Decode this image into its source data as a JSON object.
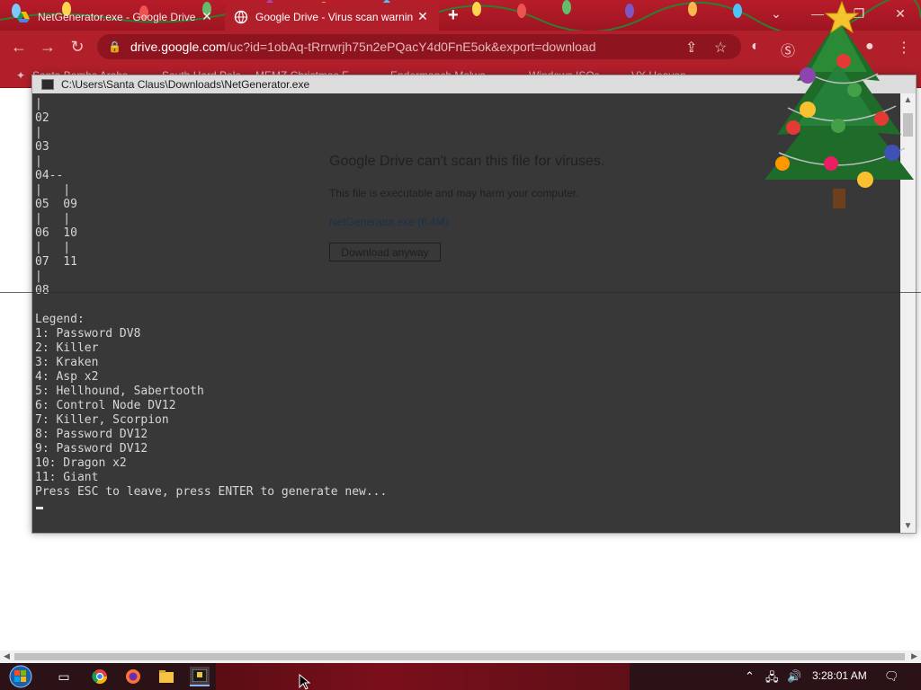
{
  "browser": {
    "tabs": [
      {
        "title": "NetGenerator.exe - Google Drive",
        "active": false
      },
      {
        "title": "Google Drive - Virus scan warnin",
        "active": true
      }
    ],
    "url_host": "drive.google.com",
    "url_path": "/uc?id=1obAq-tRrrwrjh75n2ePQacY4d0FnE5ok&export=download",
    "bookmarks": [
      "Santa Bombs Arabs",
      "South Hard Pole",
      "MEMZ Christmas E...",
      "Endermanch Malwa...",
      "Windows ISOs",
      "VX Heaven"
    ]
  },
  "drive_warning": {
    "heading": "Google Drive can't scan this file for viruses.",
    "message": "This file is executable and may harm your computer.",
    "file_link": "NetGenerator.exe",
    "file_size": "(6.4M)",
    "button": "Download anyway"
  },
  "console": {
    "title": "C:\\Users\\Santa Claus\\Downloads\\NetGenerator.exe",
    "lines": [
      "|",
      "02",
      "|",
      "03",
      "|",
      "04--",
      "|   |",
      "05  09",
      "|   |",
      "06  10",
      "|   |",
      "07  11",
      "|",
      "08",
      "",
      "Legend:",
      "1: Password DV8",
      "2: Killer",
      "3: Kraken",
      "4: Asp x2",
      "5: Hellhound, Sabertooth",
      "6: Control Node DV12",
      "7: Killer, Scorpion",
      "8: Password DV12",
      "9: Password DV12",
      "10: Dragon x2",
      "11: Giant",
      "Press ESC to leave, press ENTER to generate new..."
    ]
  },
  "taskbar": {
    "time": "3:28:01 AM"
  },
  "colors": {
    "chrome_red": "#b11f2b",
    "console_bg": "#383838",
    "console_text": "#d6d6d6"
  }
}
